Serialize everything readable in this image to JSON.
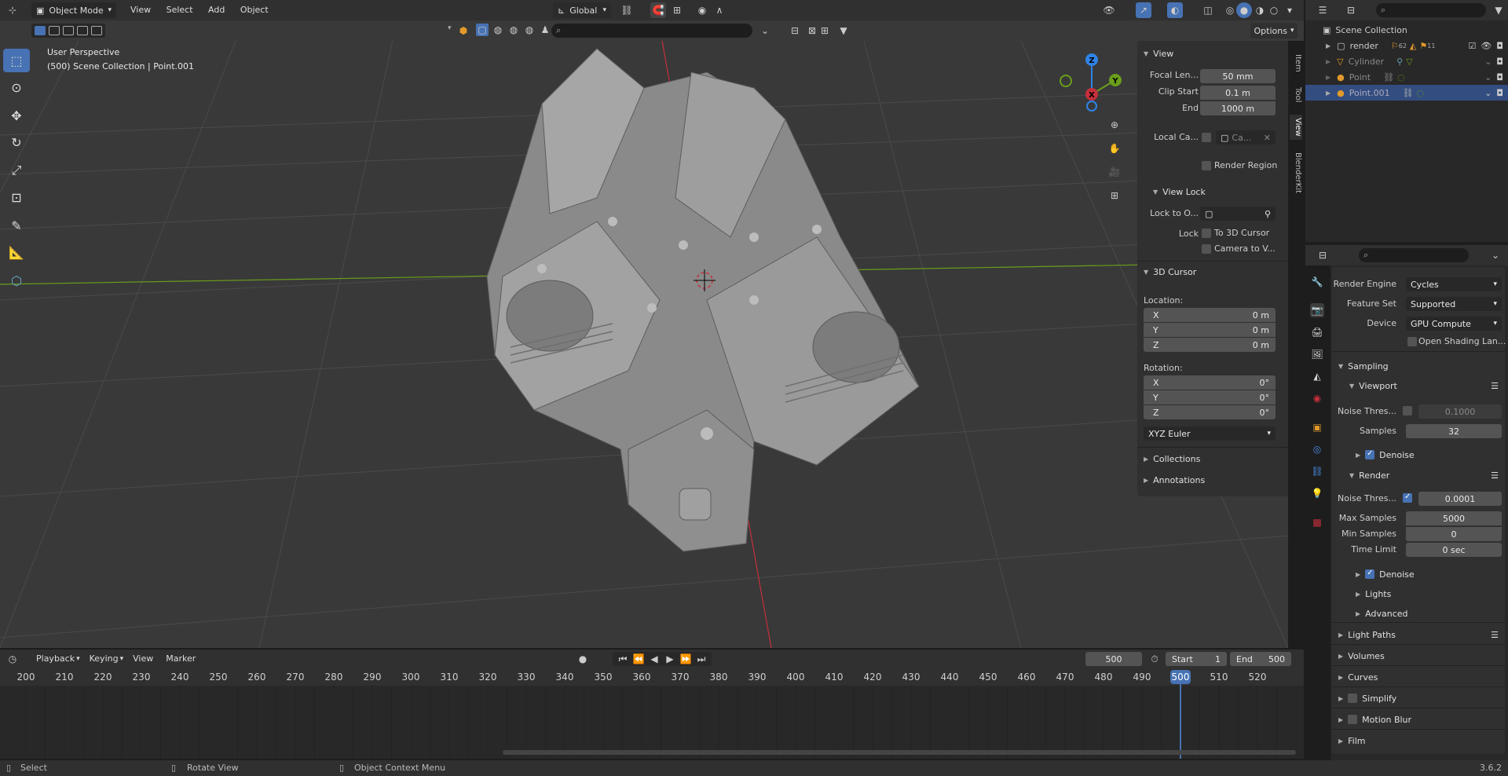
{
  "header": {
    "mode": "Object Mode",
    "menus": [
      "View",
      "Select",
      "Add",
      "Object"
    ],
    "transform_orientation": "Global",
    "options": "Options"
  },
  "viewport": {
    "perspective": "User Perspective",
    "collection_info": "(500) Scene Collection | Point.001"
  },
  "npanel": {
    "tabs": [
      "Item",
      "Tool",
      "View",
      "BlenderKit"
    ],
    "view": {
      "title": "View",
      "focal_label": "Focal Len...",
      "focal_value": "50 mm",
      "clip_start_label": "Clip Start",
      "clip_start_value": "0.1 m",
      "end_label": "End",
      "end_value": "1000 m",
      "local_camera_label": "Local Ca...",
      "local_camera_value": "Ca...",
      "render_region": "Render Region"
    },
    "view_lock": {
      "title": "View Lock",
      "lock_to_label": "Lock to O...",
      "lock_label": "Lock",
      "to_3d_cursor": "To 3D Cursor",
      "camera_to_view": "Camera to V..."
    },
    "cursor": {
      "title": "3D Cursor",
      "location_label": "Location:",
      "rotation_label": "Rotation:",
      "loc": [
        {
          "axis": "X",
          "value": "0 m"
        },
        {
          "axis": "Y",
          "value": "0 m"
        },
        {
          "axis": "Z",
          "value": "0 m"
        }
      ],
      "rot": [
        {
          "axis": "X",
          "value": "0°"
        },
        {
          "axis": "Y",
          "value": "0°"
        },
        {
          "axis": "Z",
          "value": "0°"
        }
      ],
      "rotation_mode": "XYZ Euler"
    },
    "collections": "Collections",
    "annotations": "Annotations"
  },
  "outliner": {
    "root": "Scene Collection",
    "items": [
      {
        "name": "render",
        "badge1": "62",
        "badge2": "11"
      },
      {
        "name": "Cylinder"
      },
      {
        "name": "Point"
      },
      {
        "name": "Point.001"
      }
    ]
  },
  "properties": {
    "render_engine_label": "Render Engine",
    "render_engine": "Cycles",
    "feature_set_label": "Feature Set",
    "feature_set": "Supported",
    "device_label": "Device",
    "device": "GPU Compute",
    "open_shading": "Open Shading Lan...",
    "sampling": "Sampling",
    "viewport": "Viewport",
    "noise_label": "Noise Thres...",
    "viewport_noise": "0.1000",
    "samples_label": "Samples",
    "viewport_samples": "32",
    "denoise": "Denoise",
    "render": "Render",
    "render_noise": "0.0001",
    "max_samples_label": "Max Samples",
    "max_samples": "5000",
    "min_samples_label": "Min Samples",
    "min_samples": "0",
    "time_limit_label": "Time Limit",
    "time_limit": "0 sec",
    "lights": "Lights",
    "advanced": "Advanced",
    "light_paths": "Light Paths",
    "volumes": "Volumes",
    "curves": "Curves",
    "simplify": "Simplify",
    "motion_blur": "Motion Blur",
    "film": "Film"
  },
  "timeline": {
    "menus": [
      "Playback",
      "Keying",
      "View",
      "Marker"
    ],
    "current_frame": "500",
    "start_label": "Start",
    "start": "1",
    "end_label": "End",
    "end": "500",
    "ticks": [
      "200",
      "210",
      "220",
      "230",
      "240",
      "250",
      "260",
      "270",
      "280",
      "290",
      "300",
      "310",
      "320",
      "330",
      "340",
      "350",
      "360",
      "370",
      "380",
      "390",
      "400",
      "410",
      "420",
      "430",
      "440",
      "450",
      "460",
      "470",
      "480",
      "490",
      "500",
      "510",
      "520"
    ]
  },
  "statusbar": {
    "select": "Select",
    "rotate": "Rotate View",
    "context": "Object Context Menu",
    "version": "3.6.2"
  },
  "colors": {
    "accent": "#4772b3",
    "x_axis": "#c5303c",
    "y_axis": "#6a9e1c",
    "z_axis": "#2f83e6",
    "viewport_bg": "#393939"
  }
}
